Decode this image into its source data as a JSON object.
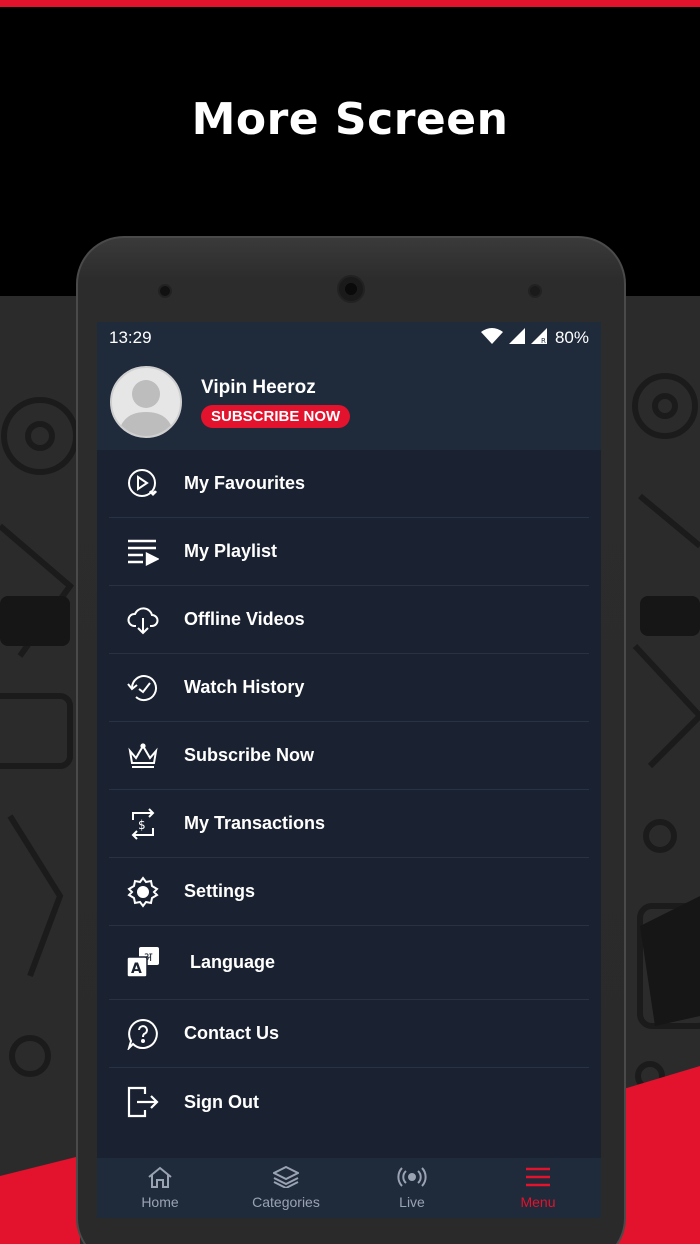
{
  "page": {
    "title": "More Screen"
  },
  "status": {
    "time": "13:29",
    "battery": "80%",
    "icons": [
      "wifi-icon",
      "signal-icon",
      "signal-roaming-icon"
    ]
  },
  "profile": {
    "name": "Vipin Heeroz",
    "subscribe_label": "SUBSCRIBE NOW"
  },
  "menu": {
    "items": [
      {
        "label": "My Favourites",
        "icon": "favourite-play-icon"
      },
      {
        "label": "My Playlist",
        "icon": "playlist-icon"
      },
      {
        "label": "Offline Videos",
        "icon": "cloud-download-icon"
      },
      {
        "label": "Watch History",
        "icon": "history-icon"
      },
      {
        "label": "Subscribe Now",
        "icon": "crown-icon"
      },
      {
        "label": "My Transactions",
        "icon": "transactions-icon"
      },
      {
        "label": "Settings",
        "icon": "gear-icon"
      },
      {
        "label": "Language",
        "icon": "language-icon"
      },
      {
        "label": "Contact Us",
        "icon": "help-chat-icon"
      },
      {
        "label": "Sign Out",
        "icon": "sign-out-icon"
      }
    ]
  },
  "bottom_nav": {
    "items": [
      {
        "label": "Home",
        "icon": "home-icon"
      },
      {
        "label": "Categories",
        "icon": "layers-icon"
      },
      {
        "label": "Live",
        "icon": "live-broadcast-icon"
      },
      {
        "label": "Menu",
        "icon": "menu-icon",
        "active": true
      }
    ]
  },
  "colors": {
    "accent": "#e3122d",
    "panel": "#1f2a3b",
    "screen": "#1a2130"
  }
}
